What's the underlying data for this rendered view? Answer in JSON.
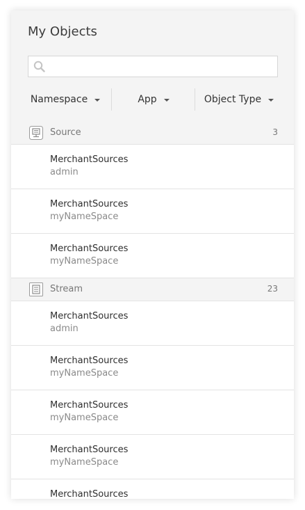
{
  "panel": {
    "title": "My Objects",
    "search": {
      "placeholder": "",
      "value": ""
    },
    "filters": [
      {
        "label": "Namespace"
      },
      {
        "label": "App"
      },
      {
        "label": "Object Type"
      }
    ]
  },
  "groups": [
    {
      "label": "Source",
      "count": "3",
      "icon": "source-icon",
      "items": [
        {
          "name": "MerchantSources",
          "namespace": "admin"
        },
        {
          "name": "MerchantSources",
          "namespace": "myNameSpace"
        },
        {
          "name": "MerchantSources",
          "namespace": "myNameSpace"
        }
      ]
    },
    {
      "label": "Stream",
      "count": "23",
      "icon": "stream-icon",
      "items": [
        {
          "name": "MerchantSources",
          "namespace": "admin"
        },
        {
          "name": "MerchantSources",
          "namespace": "myNameSpace"
        },
        {
          "name": "MerchantSources",
          "namespace": "myNameSpace"
        },
        {
          "name": "MerchantSources",
          "namespace": "myNameSpace"
        },
        {
          "name": "MerchantSources",
          "namespace": ""
        }
      ]
    }
  ],
  "colors": {
    "header_bg": "#f4f4f4",
    "border": "#e3e3e3",
    "text_primary": "#2e2e2e",
    "text_secondary": "#8a8a8a"
  }
}
